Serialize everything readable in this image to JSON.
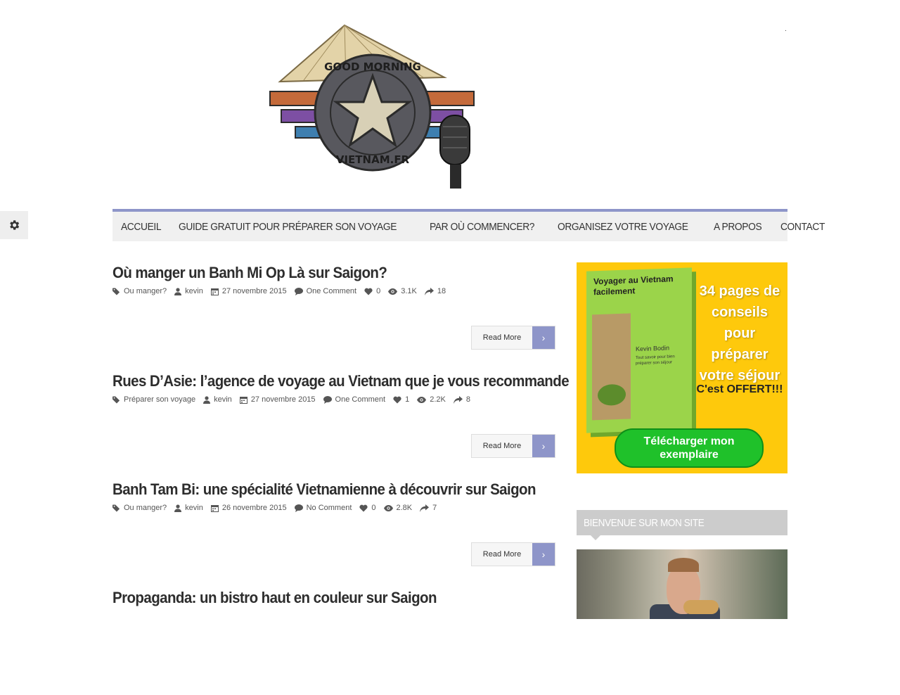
{
  "site": {
    "logo_alt": "Good Morning Vietnam.fr",
    "logo_text_top": "GOOD MORNING",
    "logo_text_bottom": "VIETNAM.FR"
  },
  "nav": {
    "items": [
      "ACCUEIL",
      "GUIDE GRATUIT POUR PRÉPARER SON VOYAGE",
      "PAR OÙ COMMENCER?",
      "ORGANISEZ VOTRE VOYAGE",
      "A PROPOS",
      "CONTACT"
    ]
  },
  "posts": [
    {
      "title": "Où manger un Banh Mi Op Là sur Saigon?",
      "category": "Ou manger?",
      "author": "kevin",
      "date": "27 novembre 2015",
      "comments": "One Comment",
      "likes": "0",
      "views": "3.1K",
      "shares": "18",
      "read_more": "Read More"
    },
    {
      "title": "Rues D’Asie: l’agence de voyage au Vietnam que je vous recommande",
      "category": "Préparer son voyage",
      "author": "kevin",
      "date": "27 novembre 2015",
      "comments": "One Comment",
      "likes": "1",
      "views": "2.2K",
      "shares": "8",
      "read_more": "Read More"
    },
    {
      "title": "Banh Tam Bi: une spécialité Vietnamienne à découvrir sur Saigon",
      "category": "Ou manger?",
      "author": "kevin",
      "date": "26 novembre 2015",
      "comments": "No Comment",
      "likes": "0",
      "views": "2.8K",
      "shares": "7",
      "read_more": "Read More"
    },
    {
      "title": "Propaganda: un bistro haut en couleur sur Saigon"
    }
  ],
  "ad": {
    "book_title": "Voyager au Vietnam facilement",
    "book_author": "Kevin Bodin",
    "book_subtitle": "Tout savoir pour bien préparer son séjour",
    "headline": "34 pages de conseils pour préparer votre séjour",
    "offer": "C'est OFFERT!!!",
    "button": "Télécharger mon exemplaire"
  },
  "widget": {
    "title": "BIENVENUE SUR MON SITE"
  },
  "colors": {
    "accent": "#8e95c9",
    "ad_background": "#fec90c",
    "ad_button": "#1fc12a"
  },
  "icons": {
    "settings": "gear-icon",
    "category": "tag-icon",
    "author": "user-icon",
    "date": "calendar-icon",
    "comments": "comment-icon",
    "likes": "heart-icon",
    "views": "eye-icon",
    "shares": "share-icon",
    "read_more": "chevron-right-icon"
  }
}
